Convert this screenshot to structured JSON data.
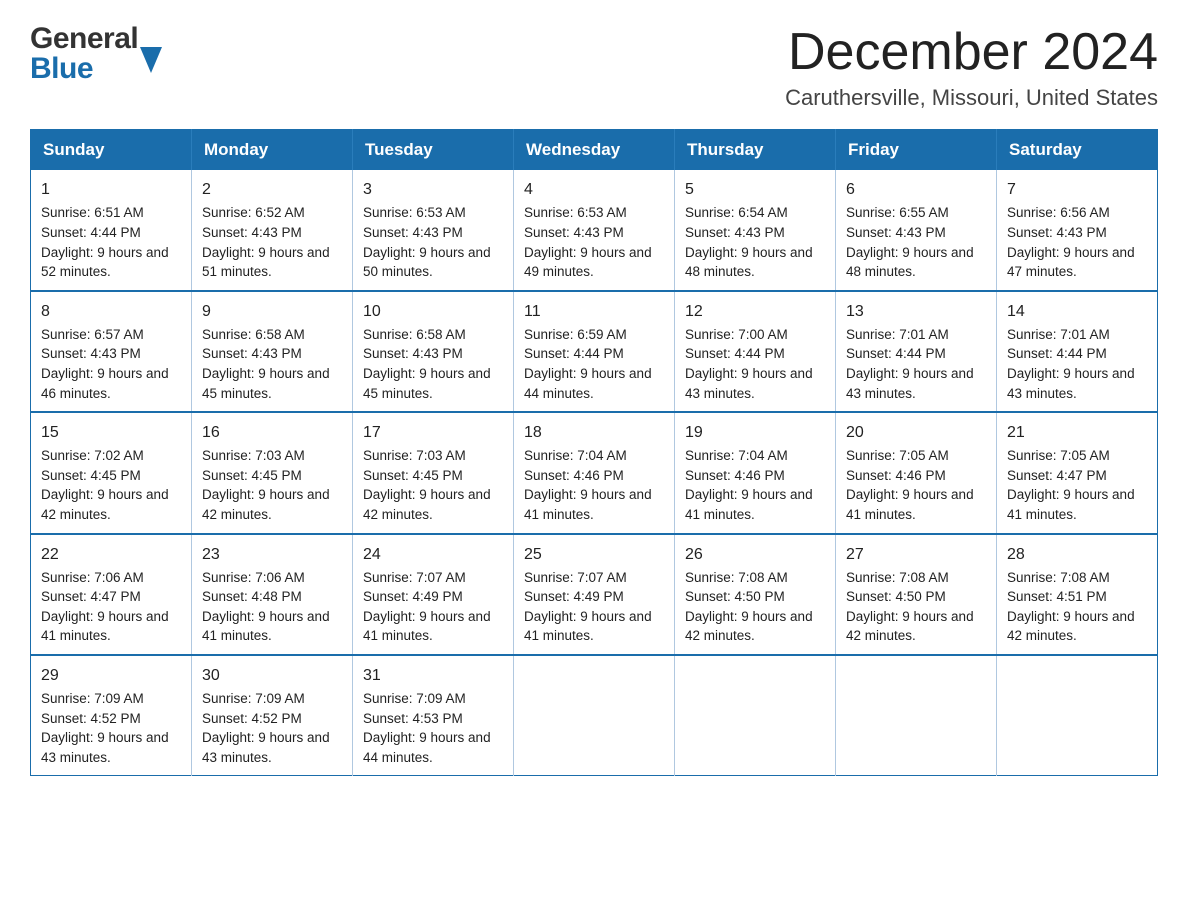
{
  "header": {
    "logo_general": "General",
    "logo_blue": "Blue",
    "title": "December 2024",
    "subtitle": "Caruthersville, Missouri, United States"
  },
  "weekdays": [
    "Sunday",
    "Monday",
    "Tuesday",
    "Wednesday",
    "Thursday",
    "Friday",
    "Saturday"
  ],
  "weeks": [
    [
      {
        "day": "1",
        "sunrise": "6:51 AM",
        "sunset": "4:44 PM",
        "daylight": "9 hours and 52 minutes."
      },
      {
        "day": "2",
        "sunrise": "6:52 AM",
        "sunset": "4:43 PM",
        "daylight": "9 hours and 51 minutes."
      },
      {
        "day": "3",
        "sunrise": "6:53 AM",
        "sunset": "4:43 PM",
        "daylight": "9 hours and 50 minutes."
      },
      {
        "day": "4",
        "sunrise": "6:53 AM",
        "sunset": "4:43 PM",
        "daylight": "9 hours and 49 minutes."
      },
      {
        "day": "5",
        "sunrise": "6:54 AM",
        "sunset": "4:43 PM",
        "daylight": "9 hours and 48 minutes."
      },
      {
        "day": "6",
        "sunrise": "6:55 AM",
        "sunset": "4:43 PM",
        "daylight": "9 hours and 48 minutes."
      },
      {
        "day": "7",
        "sunrise": "6:56 AM",
        "sunset": "4:43 PM",
        "daylight": "9 hours and 47 minutes."
      }
    ],
    [
      {
        "day": "8",
        "sunrise": "6:57 AM",
        "sunset": "4:43 PM",
        "daylight": "9 hours and 46 minutes."
      },
      {
        "day": "9",
        "sunrise": "6:58 AM",
        "sunset": "4:43 PM",
        "daylight": "9 hours and 45 minutes."
      },
      {
        "day": "10",
        "sunrise": "6:58 AM",
        "sunset": "4:43 PM",
        "daylight": "9 hours and 45 minutes."
      },
      {
        "day": "11",
        "sunrise": "6:59 AM",
        "sunset": "4:44 PM",
        "daylight": "9 hours and 44 minutes."
      },
      {
        "day": "12",
        "sunrise": "7:00 AM",
        "sunset": "4:44 PM",
        "daylight": "9 hours and 43 minutes."
      },
      {
        "day": "13",
        "sunrise": "7:01 AM",
        "sunset": "4:44 PM",
        "daylight": "9 hours and 43 minutes."
      },
      {
        "day": "14",
        "sunrise": "7:01 AM",
        "sunset": "4:44 PM",
        "daylight": "9 hours and 43 minutes."
      }
    ],
    [
      {
        "day": "15",
        "sunrise": "7:02 AM",
        "sunset": "4:45 PM",
        "daylight": "9 hours and 42 minutes."
      },
      {
        "day": "16",
        "sunrise": "7:03 AM",
        "sunset": "4:45 PM",
        "daylight": "9 hours and 42 minutes."
      },
      {
        "day": "17",
        "sunrise": "7:03 AM",
        "sunset": "4:45 PM",
        "daylight": "9 hours and 42 minutes."
      },
      {
        "day": "18",
        "sunrise": "7:04 AM",
        "sunset": "4:46 PM",
        "daylight": "9 hours and 41 minutes."
      },
      {
        "day": "19",
        "sunrise": "7:04 AM",
        "sunset": "4:46 PM",
        "daylight": "9 hours and 41 minutes."
      },
      {
        "day": "20",
        "sunrise": "7:05 AM",
        "sunset": "4:46 PM",
        "daylight": "9 hours and 41 minutes."
      },
      {
        "day": "21",
        "sunrise": "7:05 AM",
        "sunset": "4:47 PM",
        "daylight": "9 hours and 41 minutes."
      }
    ],
    [
      {
        "day": "22",
        "sunrise": "7:06 AM",
        "sunset": "4:47 PM",
        "daylight": "9 hours and 41 minutes."
      },
      {
        "day": "23",
        "sunrise": "7:06 AM",
        "sunset": "4:48 PM",
        "daylight": "9 hours and 41 minutes."
      },
      {
        "day": "24",
        "sunrise": "7:07 AM",
        "sunset": "4:49 PM",
        "daylight": "9 hours and 41 minutes."
      },
      {
        "day": "25",
        "sunrise": "7:07 AM",
        "sunset": "4:49 PM",
        "daylight": "9 hours and 41 minutes."
      },
      {
        "day": "26",
        "sunrise": "7:08 AM",
        "sunset": "4:50 PM",
        "daylight": "9 hours and 42 minutes."
      },
      {
        "day": "27",
        "sunrise": "7:08 AM",
        "sunset": "4:50 PM",
        "daylight": "9 hours and 42 minutes."
      },
      {
        "day": "28",
        "sunrise": "7:08 AM",
        "sunset": "4:51 PM",
        "daylight": "9 hours and 42 minutes."
      }
    ],
    [
      {
        "day": "29",
        "sunrise": "7:09 AM",
        "sunset": "4:52 PM",
        "daylight": "9 hours and 43 minutes."
      },
      {
        "day": "30",
        "sunrise": "7:09 AM",
        "sunset": "4:52 PM",
        "daylight": "9 hours and 43 minutes."
      },
      {
        "day": "31",
        "sunrise": "7:09 AM",
        "sunset": "4:53 PM",
        "daylight": "9 hours and 44 minutes."
      },
      null,
      null,
      null,
      null
    ]
  ],
  "labels": {
    "sunrise": "Sunrise: ",
    "sunset": "Sunset: ",
    "daylight": "Daylight: "
  }
}
